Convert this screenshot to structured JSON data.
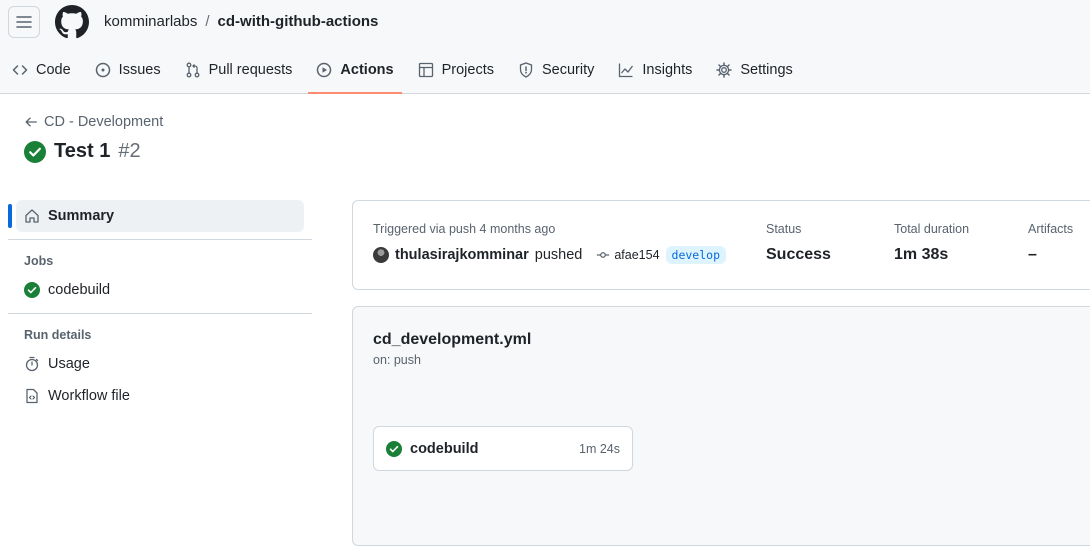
{
  "header": {
    "owner": "komminarlabs",
    "separator": "/",
    "repo": "cd-with-github-actions"
  },
  "tabs": [
    {
      "label": "Code",
      "icon": "code-icon"
    },
    {
      "label": "Issues",
      "icon": "issue-icon"
    },
    {
      "label": "Pull requests",
      "icon": "pull-request-icon"
    },
    {
      "label": "Actions",
      "icon": "play-icon",
      "active": true
    },
    {
      "label": "Projects",
      "icon": "table-icon"
    },
    {
      "label": "Security",
      "icon": "shield-icon"
    },
    {
      "label": "Insights",
      "icon": "graph-icon"
    },
    {
      "label": "Settings",
      "icon": "gear-icon"
    }
  ],
  "run": {
    "back_label": "CD - Development",
    "title": "Test 1",
    "number": "#2"
  },
  "sidebar": {
    "summary_label": "Summary",
    "jobs_heading": "Jobs",
    "jobs": [
      {
        "label": "codebuild",
        "status": "success"
      }
    ],
    "run_details_heading": "Run details",
    "usage_label": "Usage",
    "workflow_file_label": "Workflow file"
  },
  "summary": {
    "trigger_text": "Triggered via push 4 months ago",
    "actor": "thulasirajkomminar",
    "action": "pushed",
    "commit": "afae154",
    "branch": "develop",
    "status_label": "Status",
    "status_value": "Success",
    "duration_label": "Total duration",
    "duration_value": "1m 38s",
    "artifacts_label": "Artifacts",
    "artifacts_value": "–"
  },
  "workflow": {
    "file": "cd_development.yml",
    "trigger": "on: push",
    "job": {
      "name": "codebuild",
      "duration": "1m 24s",
      "status": "success"
    }
  },
  "colors": {
    "success": "#1a7f37",
    "active_tab_underline": "#fd8c73",
    "selected_indicator": "#0969da"
  }
}
